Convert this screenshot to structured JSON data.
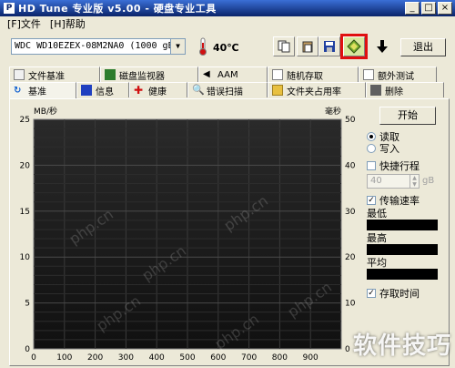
{
  "window": {
    "icon_letter": "P",
    "title": "HD Tune 专业版 v5.00 - 硬盘专业工具",
    "buttons": [
      "_",
      "□",
      "×"
    ]
  },
  "menu": [
    {
      "label": "[F]文件"
    },
    {
      "label": "[H]帮助"
    }
  ],
  "toolbar": {
    "drive": "WDC WD10EZEX-08M2NA0 (1000 gB)",
    "temperature": "40℃",
    "exit_label": "退出",
    "icons": [
      "copy-icon",
      "paste-icon",
      "save-icon",
      "screenshot-icon",
      "download-icon"
    ]
  },
  "tabs_back": [
    {
      "label": "文件基准",
      "icon": "file-benchmark-icon"
    },
    {
      "label": "磁盘监视器",
      "icon": "disk-monitor-icon"
    },
    {
      "label": "AAM",
      "icon": "speaker-icon"
    },
    {
      "label": "随机存取",
      "icon": "random-access-icon"
    },
    {
      "label": "额外测试",
      "icon": "extra-tests-icon"
    }
  ],
  "tabs_front": [
    {
      "label": "基准",
      "icon": "benchmark-icon",
      "active": true
    },
    {
      "label": "信息",
      "icon": "info-icon"
    },
    {
      "label": "健康",
      "icon": "health-icon"
    },
    {
      "label": "错误扫描",
      "icon": "error-scan-icon"
    },
    {
      "label": "文件夹占用率",
      "icon": "folder-usage-icon"
    },
    {
      "label": "删除",
      "icon": "erase-icon"
    }
  ],
  "chart": {
    "left_unit": "MB/秒",
    "right_unit": "毫秒",
    "left_ticks": [
      "25",
      "20",
      "15",
      "10",
      "5",
      "0"
    ],
    "right_ticks": [
      "50",
      "40",
      "30",
      "20",
      "10",
      "0"
    ],
    "x_ticks": [
      "0",
      "100",
      "200",
      "300",
      "400",
      "500",
      "600",
      "700",
      "800",
      "900"
    ],
    "watermarks": [
      "php.cn",
      "php.cn",
      "php.cn",
      "php.cn",
      "php.cn",
      "php.cn"
    ]
  },
  "chart_data": {
    "type": "line",
    "series": [],
    "xlim": [
      0,
      1000
    ],
    "ylim_left": [
      0,
      25
    ],
    "ylim_right": [
      0,
      50
    ],
    "ylabel_left": "MB/秒",
    "ylabel_right": "毫秒",
    "grid": true
  },
  "side": {
    "start_label": "开始",
    "read_label": "读取",
    "write_label": "写入",
    "short_stroke_label": "快捷行程",
    "short_stroke_value": "40",
    "short_stroke_unit": "gB",
    "transfer_rate_label": "传输速率",
    "min_label": "最低",
    "max_label": "最高",
    "avg_label": "平均",
    "access_time_label": "存取时间"
  },
  "overlay_watermark": "软件技巧",
  "colors": {
    "highlight": "#e01010",
    "plot_bg": "#1a1a1a",
    "grid": "#3a3a3a"
  }
}
